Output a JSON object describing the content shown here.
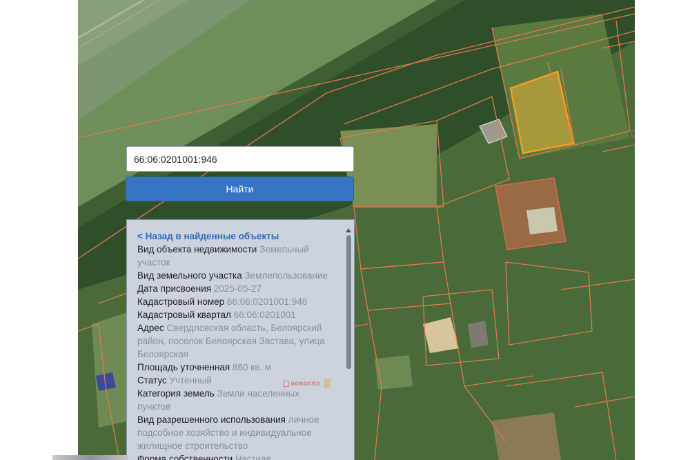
{
  "search": {
    "value": "66:06:0201001:946",
    "button_label": "Найти"
  },
  "panel": {
    "back_link": "< Назад в найденные объекты",
    "rows": [
      {
        "label": "Вид объекта недвижимости",
        "value": "Земельный участок"
      },
      {
        "label": "Вид земельного участка",
        "value": "Землепользование"
      },
      {
        "label": "Дата присвоения",
        "value": "2025-05-27"
      },
      {
        "label": "Кадастровый номер",
        "value": "66:06:0201001:946"
      },
      {
        "label": "Кадастровый квартал",
        "value": "66:06:0201001"
      },
      {
        "label": "Адрес",
        "value": "Свердловская область, Белоярский район, поселок Белоярская Застава, улица Белоярская"
      },
      {
        "label": "Площадь уточненная",
        "value": "860 кв. м"
      },
      {
        "label": "Статус",
        "value": "Учтенный"
      },
      {
        "label": "Категория земель",
        "value": "Земли населенных пунктов"
      },
      {
        "label": "Вид разрешенного использования",
        "value": "личное подсобное хозяйство и индивидуальное жилищное строительство"
      },
      {
        "label": "Форма собственности",
        "value": "Частная"
      }
    ]
  },
  "watermark": {
    "text": "новосёл"
  },
  "colors": {
    "button": "#3774c4",
    "link": "#2d6ab4",
    "panel_bg": "#ccd3de",
    "parcel_border": "#e07a4a",
    "selected_parcel": "#f0a020"
  }
}
